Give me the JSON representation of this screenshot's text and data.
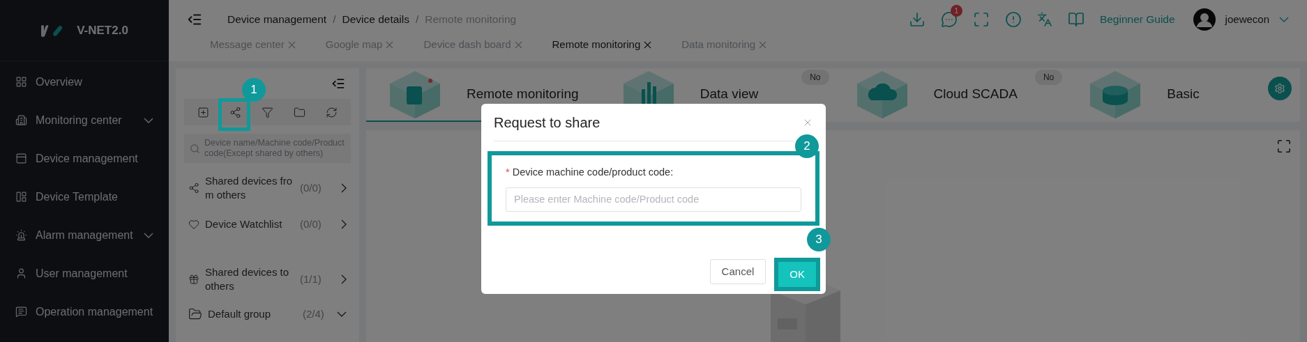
{
  "sidebar": {
    "logo": "V-NET2.0",
    "items": [
      {
        "label": "Overview",
        "kind": "link"
      },
      {
        "label": "Monitoring center",
        "kind": "group"
      },
      {
        "label": "Device management",
        "kind": "link"
      },
      {
        "label": "Device Template",
        "kind": "link"
      },
      {
        "label": "Alarm management",
        "kind": "group"
      },
      {
        "label": "User management",
        "kind": "link"
      },
      {
        "label": "Operation management",
        "kind": "link"
      }
    ]
  },
  "header": {
    "separators": [
      "/",
      "/"
    ],
    "breadcrumb": [
      {
        "label": "Device management",
        "current": false
      },
      {
        "label": "Device details",
        "current": false
      },
      {
        "label": "Remote monitoring",
        "current": true
      }
    ],
    "message_badge": "1",
    "guide_link": "Beginner Guide",
    "user": "joewecon"
  },
  "tabs": [
    {
      "label": "Message center",
      "selected": false
    },
    {
      "label": "Google map",
      "selected": false
    },
    {
      "label": "Device dash board",
      "selected": false
    },
    {
      "label": "Remote monitoring",
      "selected": true
    },
    {
      "label": "Data monitoring",
      "selected": false
    }
  ],
  "device_panel": {
    "search": {
      "placeholder": "Device name/Machine code/Product code(Except shared by others)"
    },
    "groups": [
      {
        "label": "Shared devices from others",
        "count": "(0/0)",
        "expanded": false
      },
      {
        "label": "Device Watchlist",
        "count": "(0/0)",
        "expanded": false
      },
      {
        "label": "Shared devices to others",
        "count": "(1/1)",
        "expanded": false
      },
      {
        "label": "Default group",
        "count": "(2/4)",
        "expanded": true
      }
    ]
  },
  "modules": [
    {
      "label": "Remote monitoring",
      "selected": true
    },
    {
      "label": "Data view",
      "selected": false,
      "badge": "No"
    },
    {
      "label": "Cloud SCADA",
      "selected": false,
      "badge": "No"
    },
    {
      "label": "Basic",
      "selected": false
    }
  ],
  "dialog": {
    "title": "Request to share",
    "field": {
      "label": "Device machine code/product code:",
      "required_mark": "*",
      "placeholder": "Please enter Machine code/Product code"
    },
    "buttons": [
      {
        "label": "Cancel",
        "kind": "secondary"
      },
      {
        "label": "OK",
        "kind": "primary"
      }
    ]
  },
  "annotations": [
    "1",
    "2",
    "3"
  ]
}
